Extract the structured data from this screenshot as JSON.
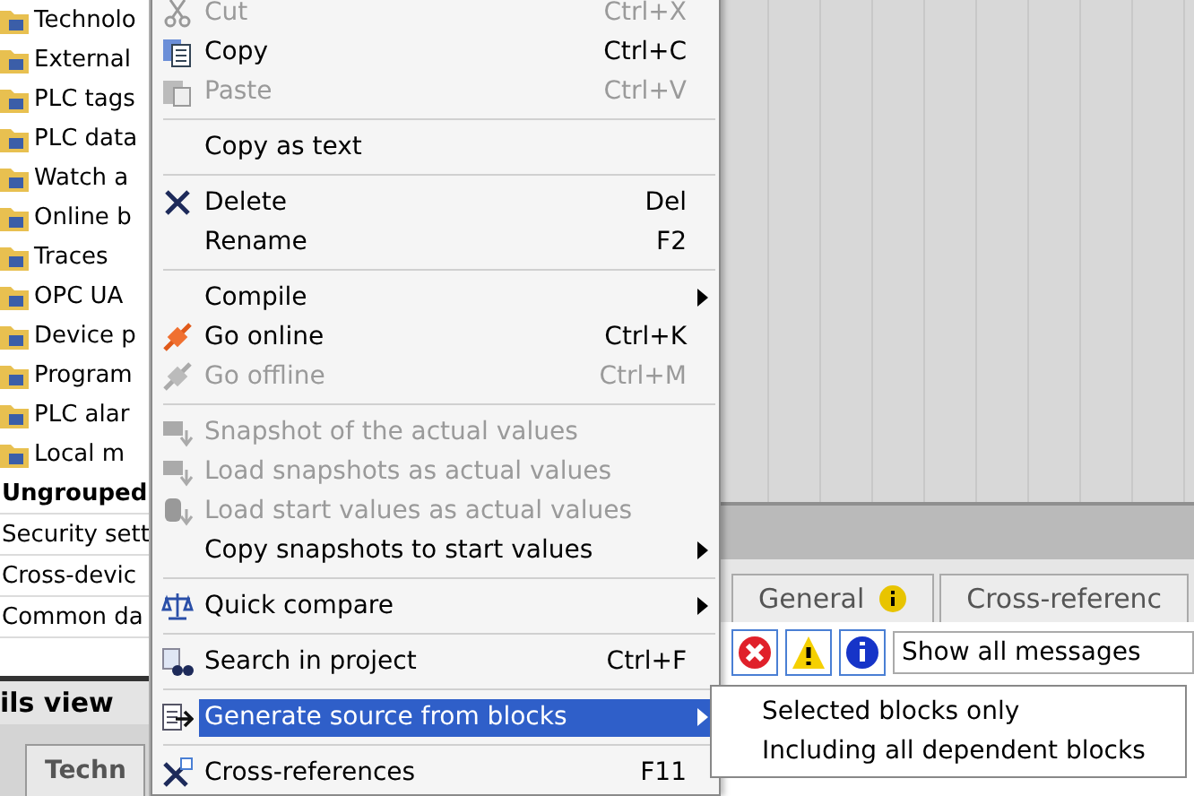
{
  "project_tree": {
    "items": [
      {
        "label": "Technolo",
        "kind": "item"
      },
      {
        "label": "External",
        "kind": "item"
      },
      {
        "label": "PLC tags",
        "kind": "item"
      },
      {
        "label": "PLC data",
        "kind": "item"
      },
      {
        "label": "Watch a",
        "kind": "item"
      },
      {
        "label": "Online b",
        "kind": "item"
      },
      {
        "label": "Traces",
        "kind": "item"
      },
      {
        "label": "OPC UA",
        "kind": "item"
      },
      {
        "label": "Device p",
        "kind": "item"
      },
      {
        "label": "Program",
        "kind": "item"
      },
      {
        "label": "PLC alar",
        "kind": "item"
      },
      {
        "label": "Local m",
        "kind": "item"
      },
      {
        "label": "Ungrouped",
        "kind": "group"
      },
      {
        "label": "Security sett",
        "kind": "group_item"
      },
      {
        "label": "Cross-devic",
        "kind": "group_item"
      },
      {
        "label": "Common da",
        "kind": "group_item"
      }
    ]
  },
  "details_view": {
    "title": "ils view",
    "tabs": [
      {
        "label": "Techn",
        "selected": false
      }
    ]
  },
  "context_menu": {
    "items": [
      {
        "kind": "item",
        "label": "Cut",
        "shortcut": "Ctrl+X",
        "disabled": true,
        "submenu": false,
        "selected": false
      },
      {
        "kind": "item",
        "label": "Copy",
        "shortcut": "Ctrl+C",
        "disabled": false,
        "submenu": false,
        "selected": false
      },
      {
        "kind": "item",
        "label": "Paste",
        "shortcut": "Ctrl+V",
        "disabled": true,
        "submenu": false,
        "selected": false
      },
      {
        "kind": "separator"
      },
      {
        "kind": "item",
        "label": "Copy as text",
        "disabled": false,
        "submenu": false,
        "selected": false
      },
      {
        "kind": "separator"
      },
      {
        "kind": "item",
        "label": "Delete",
        "shortcut": "Del",
        "disabled": false,
        "submenu": false,
        "selected": false
      },
      {
        "kind": "item",
        "label": "Rename",
        "shortcut": "F2",
        "disabled": false,
        "submenu": false,
        "selected": false
      },
      {
        "kind": "separator"
      },
      {
        "kind": "item",
        "label": "Compile",
        "disabled": false,
        "submenu": true,
        "selected": false
      },
      {
        "kind": "item",
        "label": "Go online",
        "shortcut": "Ctrl+K",
        "disabled": false,
        "submenu": false,
        "selected": false
      },
      {
        "kind": "item",
        "label": "Go offline",
        "shortcut": "Ctrl+M",
        "disabled": true,
        "submenu": false,
        "selected": false
      },
      {
        "kind": "separator"
      },
      {
        "kind": "item",
        "label": "Snapshot of the actual values",
        "disabled": true,
        "submenu": false,
        "selected": false
      },
      {
        "kind": "item",
        "label": "Load snapshots as actual values",
        "disabled": true,
        "submenu": false,
        "selected": false
      },
      {
        "kind": "item",
        "label": "Load start values as actual values",
        "disabled": true,
        "submenu": false,
        "selected": false
      },
      {
        "kind": "item",
        "label": "Copy snapshots to start values",
        "disabled": false,
        "submenu": true,
        "selected": false
      },
      {
        "kind": "separator"
      },
      {
        "kind": "item",
        "label": "Quick compare",
        "disabled": false,
        "submenu": true,
        "selected": false
      },
      {
        "kind": "separator"
      },
      {
        "kind": "item",
        "label": "Search in project",
        "shortcut": "Ctrl+F",
        "disabled": false,
        "submenu": false,
        "selected": false
      },
      {
        "kind": "separator"
      },
      {
        "kind": "item",
        "label": "Generate source from blocks",
        "disabled": false,
        "submenu": true,
        "selected": true
      },
      {
        "kind": "separator"
      },
      {
        "kind": "item",
        "label": "Cross-references",
        "shortcut": "F11",
        "disabled": false,
        "submenu": false,
        "selected": false
      }
    ]
  },
  "submenu": {
    "items": [
      {
        "label": "Selected blocks only"
      },
      {
        "label": "Including all dependent blocks"
      }
    ]
  },
  "inspector": {
    "tabs": [
      {
        "label": "General",
        "selected": false,
        "info": true
      },
      {
        "label": "Cross-referenc",
        "selected": false,
        "info": false
      }
    ],
    "filters": [
      {
        "kind": "error",
        "on": true
      },
      {
        "kind": "warning",
        "on": true
      },
      {
        "kind": "info",
        "on": true
      }
    ],
    "message_filter": {
      "value": "Show all messages"
    }
  }
}
